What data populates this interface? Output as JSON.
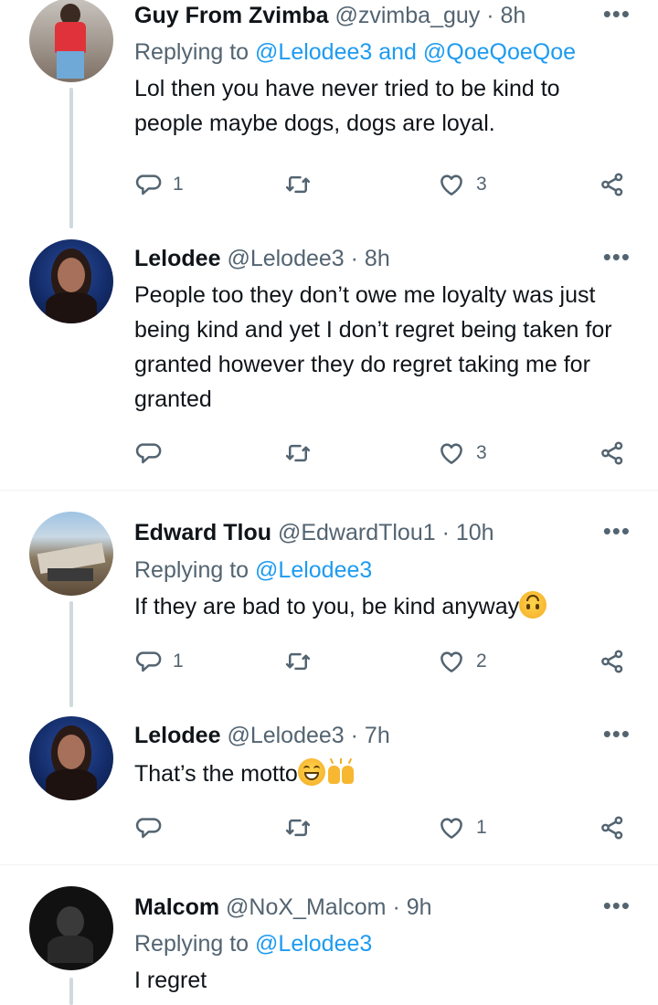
{
  "tweets": [
    {
      "name": "Guy From Zvimba",
      "handle": "@zvimba_guy",
      "time": "· 8h",
      "replying_prefix": "Replying to ",
      "replying_to": "@Lelodee3 and @QoeQoeQoe",
      "text": "Lol then you have never tried to be kind to people maybe dogs, dogs are loyal.",
      "reply_count": "1",
      "retweet_count": "",
      "like_count": "3"
    },
    {
      "name": "Lelodee",
      "handle": "@Lelodee3",
      "time": "· 8h",
      "text": "People too they don’t owe me loyalty was just being kind and yet I don’t regret being taken for granted however they do regret taking me for granted",
      "reply_count": "",
      "retweet_count": "",
      "like_count": "3"
    },
    {
      "name": "Edward Tlou",
      "handle": "@EdwardTlou1",
      "time": "· 10h",
      "replying_prefix": "Replying to ",
      "replying_to": "@Lelodee3",
      "text": "If they are bad to you, be kind anyway",
      "reply_count": "1",
      "retweet_count": "",
      "like_count": "2"
    },
    {
      "name": "Lelodee",
      "handle": "@Lelodee3",
      "time": "· 7h",
      "text": "That’s the motto",
      "reply_count": "",
      "retweet_count": "",
      "like_count": "1"
    },
    {
      "name": "Malcom",
      "handle": "@NoX_Malcom",
      "time": "· 9h",
      "replying_prefix": "Replying to ",
      "replying_to": "@Lelodee3",
      "text": "I regret"
    }
  ],
  "icons": {
    "reply": "reply-icon",
    "retweet": "retweet-icon",
    "like": "heart-icon",
    "share": "share-icon",
    "more": "more-icon"
  },
  "more_glyph": "•••",
  "colors": {
    "link": "#1d9bf0",
    "secondary": "#536471",
    "divider": "#eff3f4",
    "thread_line": "#cfd9de"
  }
}
